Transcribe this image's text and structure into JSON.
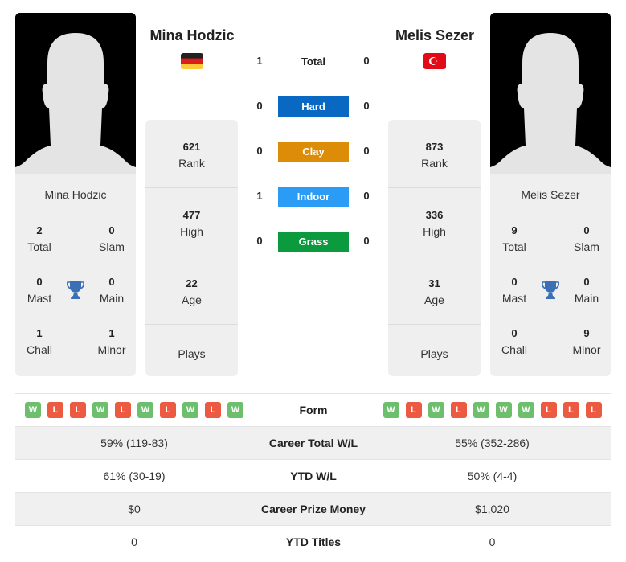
{
  "colors": {
    "hard": "#0868c2",
    "clay": "#dd8c08",
    "indoor": "#2b9cf5",
    "grass": "#0b9a3d",
    "win": "#6dbf6d",
    "loss": "#ec5a42",
    "trophy": "#3b6fb6"
  },
  "player1": {
    "name": "Mina Hodzic",
    "flag": "germany-flag",
    "titles": {
      "total": "2",
      "total_label": "Total",
      "slam": "0",
      "slam_label": "Slam",
      "mast": "0",
      "mast_label": "Mast",
      "main": "0",
      "main_label": "Main",
      "chall": "1",
      "chall_label": "Chall",
      "minor": "1",
      "minor_label": "Minor"
    },
    "rank": "621",
    "rank_label": "Rank",
    "high": "477",
    "high_label": "High",
    "age": "22",
    "age_label": "Age",
    "plays_label": "Plays",
    "form": [
      "W",
      "L",
      "L",
      "W",
      "L",
      "W",
      "L",
      "W",
      "L",
      "W"
    ]
  },
  "player2": {
    "name": "Melis Sezer",
    "flag": "turkey-flag",
    "titles": {
      "total": "9",
      "total_label": "Total",
      "slam": "0",
      "slam_label": "Slam",
      "mast": "0",
      "mast_label": "Mast",
      "main": "0",
      "main_label": "Main",
      "chall": "0",
      "chall_label": "Chall",
      "minor": "9",
      "minor_label": "Minor"
    },
    "rank": "873",
    "rank_label": "Rank",
    "high": "336",
    "high_label": "High",
    "age": "31",
    "age_label": "Age",
    "plays_label": "Plays",
    "form": [
      "W",
      "L",
      "W",
      "L",
      "W",
      "W",
      "W",
      "L",
      "L",
      "L"
    ]
  },
  "h2h": [
    {
      "label": "Total",
      "left": "1",
      "right": "0",
      "surface": "total"
    },
    {
      "label": "Hard",
      "left": "0",
      "right": "0",
      "surface": "hard"
    },
    {
      "label": "Clay",
      "left": "0",
      "right": "0",
      "surface": "clay"
    },
    {
      "label": "Indoor",
      "left": "1",
      "right": "0",
      "surface": "indoor"
    },
    {
      "label": "Grass",
      "left": "0",
      "right": "0",
      "surface": "grass"
    }
  ],
  "comparison": {
    "form_label": "Form",
    "rows": [
      {
        "label": "Career Total W/L",
        "left": "59% (119-83)",
        "right": "55% (352-286)"
      },
      {
        "label": "YTD W/L",
        "left": "61% (30-19)",
        "right": "50% (4-4)"
      },
      {
        "label": "Career Prize Money",
        "left": "$0",
        "right": "$1,020"
      },
      {
        "label": "YTD Titles",
        "left": "0",
        "right": "0"
      }
    ]
  }
}
